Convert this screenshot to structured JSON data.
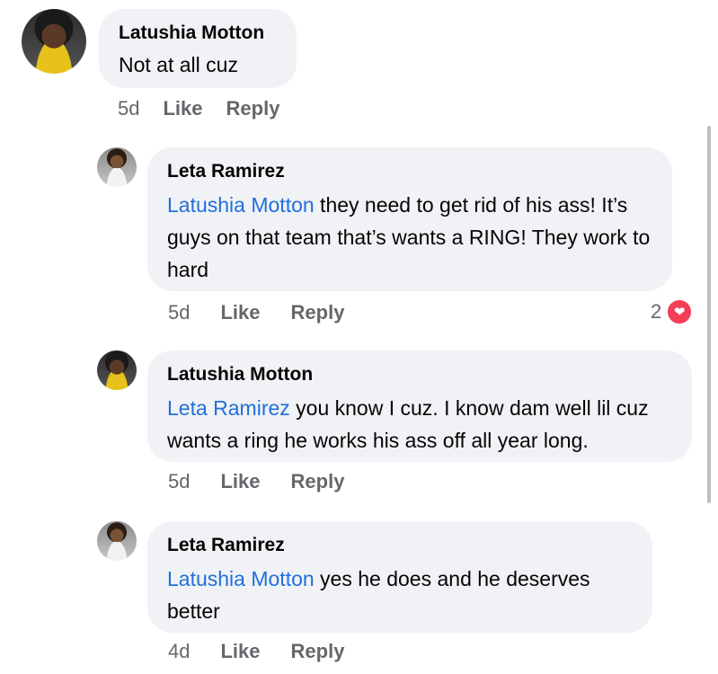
{
  "comments": [
    {
      "author": "Latushia Motton",
      "mention": "",
      "text": "Not at all cuz",
      "time": "5d",
      "like": "Like",
      "reply": "Reply"
    },
    {
      "author": "Leta Ramirez",
      "mention": "Latushia Motton",
      "text": " they need to get rid of his ass! It’s guys on that team that’s wants a RING! They work to hard",
      "time": "5d",
      "like": "Like",
      "reply": "Reply",
      "reaction_count": "2",
      "reaction_icon": "heart-icon"
    },
    {
      "author": "Latushia Motton",
      "mention": "Leta Ramirez",
      "text": " you know I cuz. I know dam well lil cuz wants a ring he works his ass off all year long.",
      "time": "5d",
      "like": "Like",
      "reply": "Reply"
    },
    {
      "author": "Leta Ramirez",
      "mention": "Latushia Motton",
      "text": " yes he does and he deserves better",
      "time": "4d",
      "like": "Like",
      "reply": "Reply"
    }
  ],
  "colors": {
    "bubble": "#f0f2f5",
    "mention": "#216fdb",
    "meta": "#65676b",
    "heart": "#f33e58"
  }
}
